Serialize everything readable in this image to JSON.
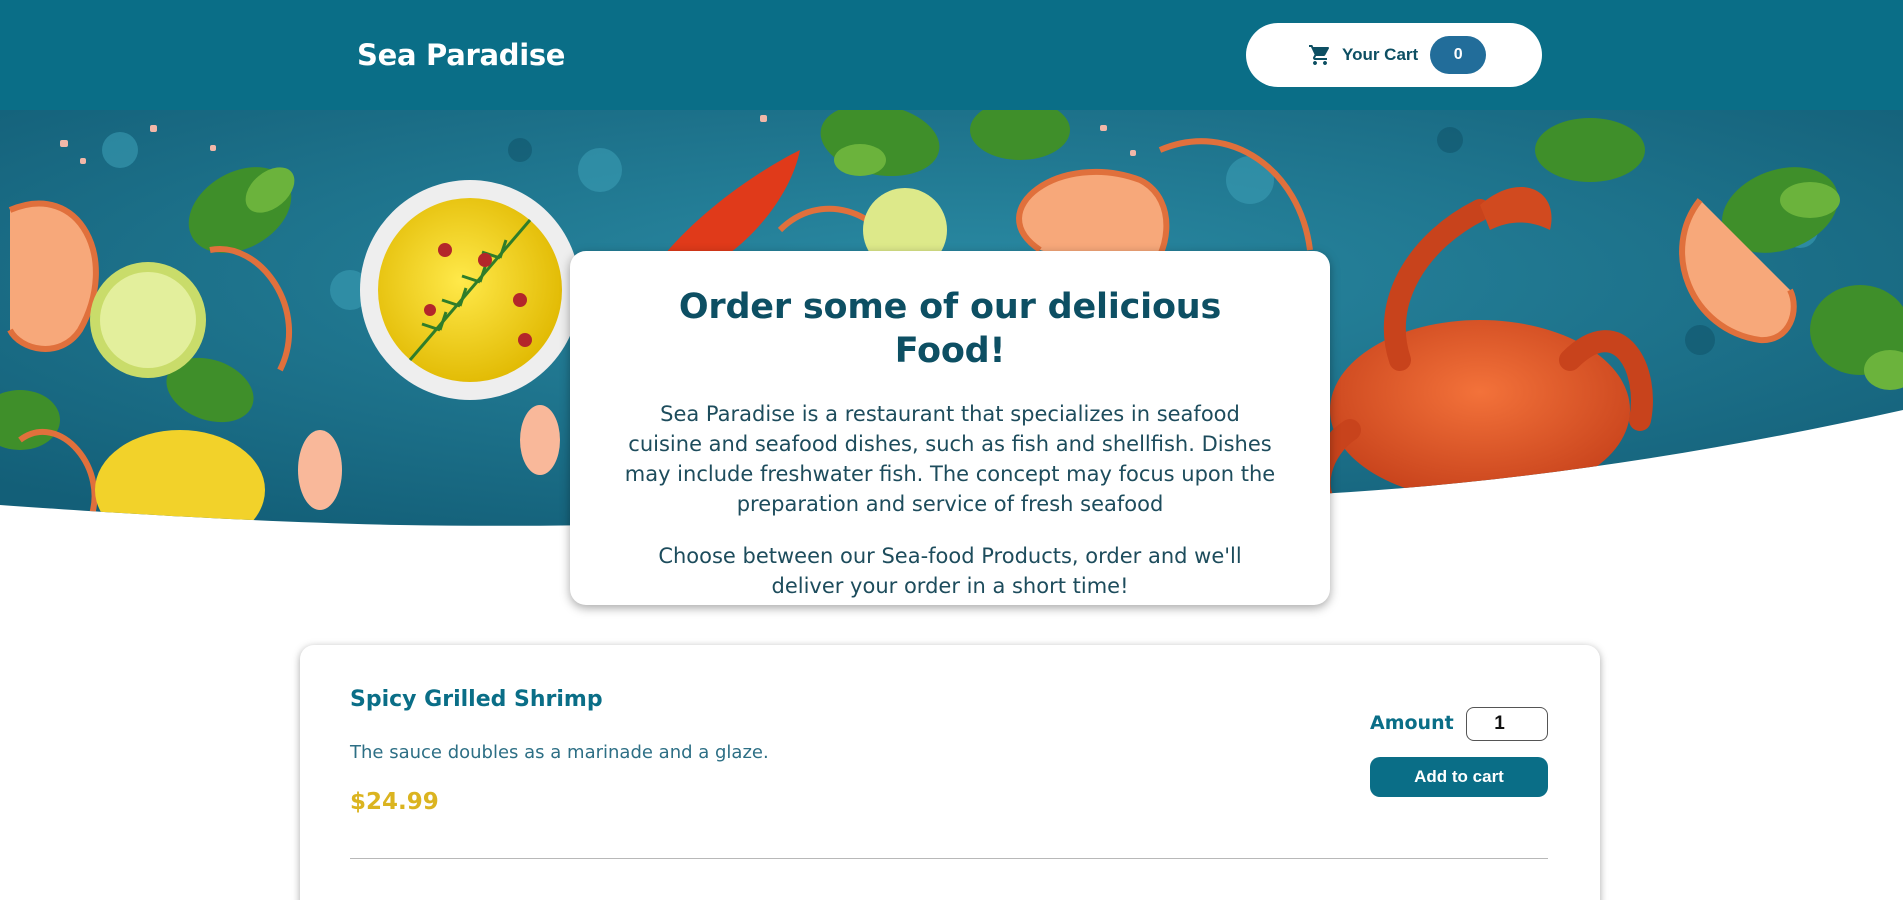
{
  "header": {
    "logo": "Sea Paradise",
    "cart": {
      "label": "Your Cart",
      "count": "0"
    }
  },
  "summary": {
    "title": "Order some of our delicious Food!",
    "paragraph1": "Sea Paradise is a restaurant that specializes in seafood cuisine and seafood dishes, such as fish and shellfish. Dishes may include freshwater fish. The concept may focus upon the preparation and service of fresh seafood",
    "paragraph2": "Choose between our Sea-food Products, order and we'll deliver your order in a short time!"
  },
  "meals": [
    {
      "name": "Spicy Grilled Shrimp",
      "description": "The sauce doubles as a marinade and a glaze.",
      "price": "$24.99",
      "amount_label": "Amount",
      "amount_value": "1",
      "add_label": "Add to cart"
    }
  ],
  "colors": {
    "header": "#0a6e87",
    "badge": "#226d9a",
    "title": "#0d4f63",
    "price": "#dbb420",
    "hero_background": "#1f7c93"
  },
  "icons": {
    "cart": "cart-icon"
  }
}
